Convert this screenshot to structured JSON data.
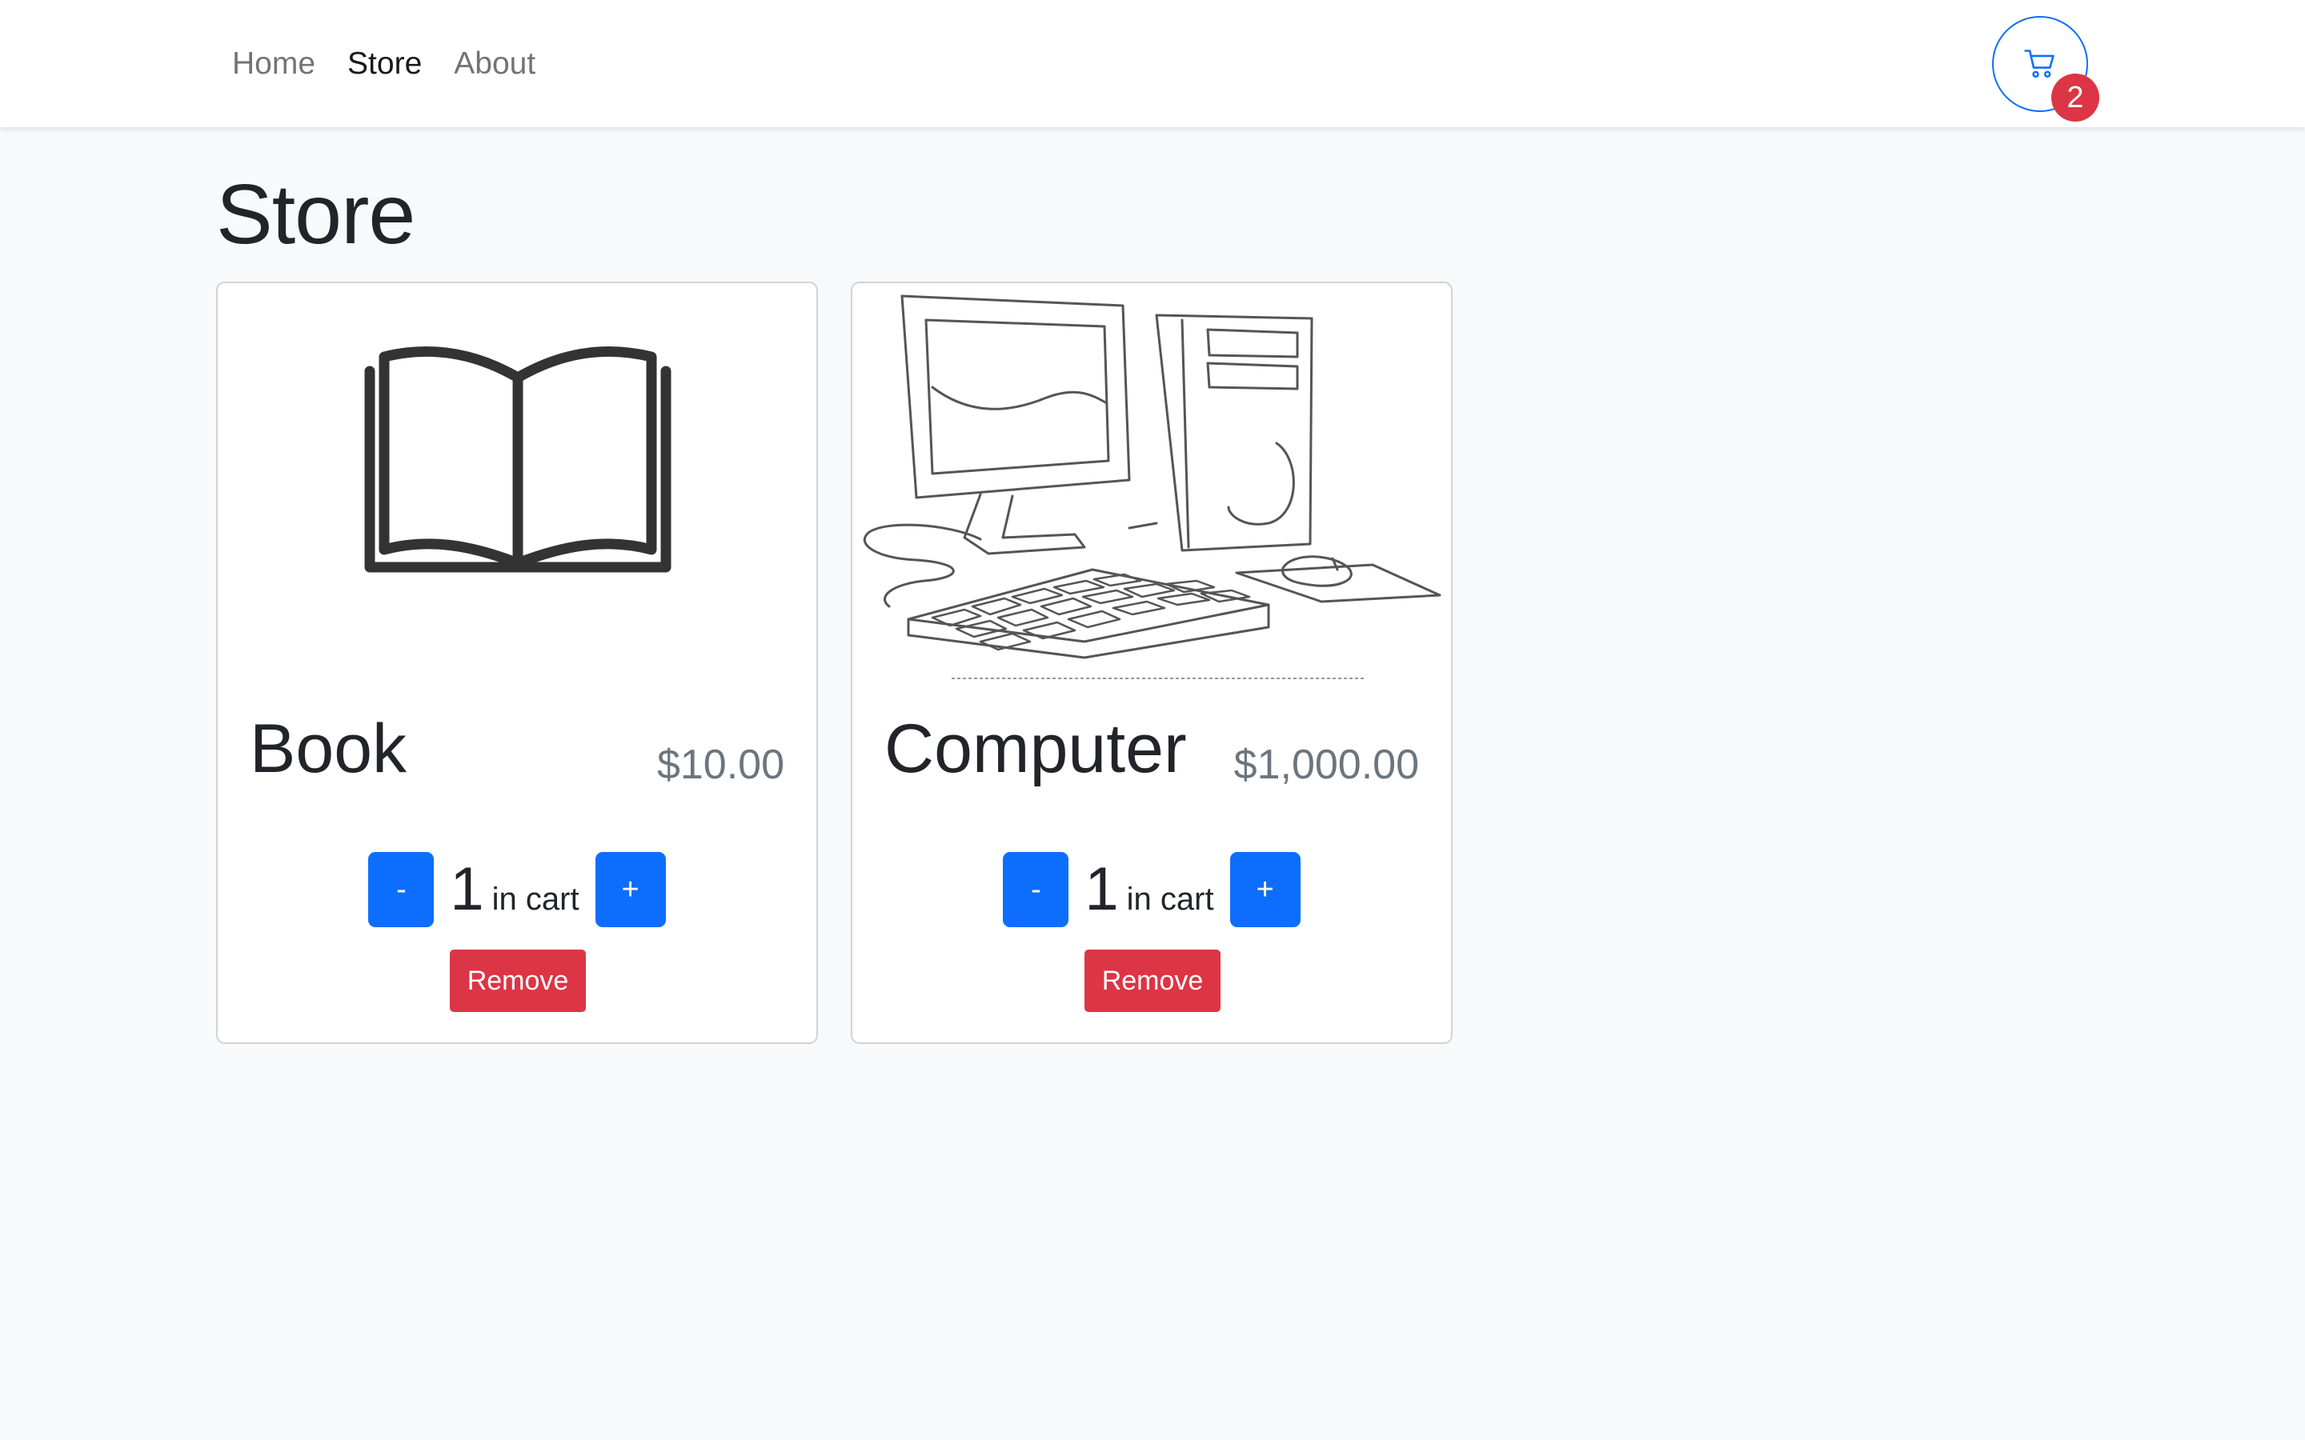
{
  "nav": {
    "links": [
      {
        "label": "Home",
        "active": false
      },
      {
        "label": "Store",
        "active": true
      },
      {
        "label": "About",
        "active": false
      }
    ],
    "cart_icon": "cart-icon",
    "cart_count": "2"
  },
  "page": {
    "title": "Store"
  },
  "products": [
    {
      "name": "Book",
      "price": "$10.00",
      "image_icon": "open-book-icon",
      "quantity": "1",
      "quantity_label": "in cart",
      "decrement_label": "-",
      "increment_label": "+",
      "remove_label": "Remove"
    },
    {
      "name": "Computer",
      "price": "$1,000.00",
      "image_icon": "desktop-computer-icon",
      "quantity": "1",
      "quantity_label": "in cart",
      "decrement_label": "-",
      "increment_label": "+",
      "remove_label": "Remove"
    }
  ],
  "colors": {
    "primary": "#0d6efd",
    "danger": "#dc3545",
    "background": "#f8f9fa"
  }
}
